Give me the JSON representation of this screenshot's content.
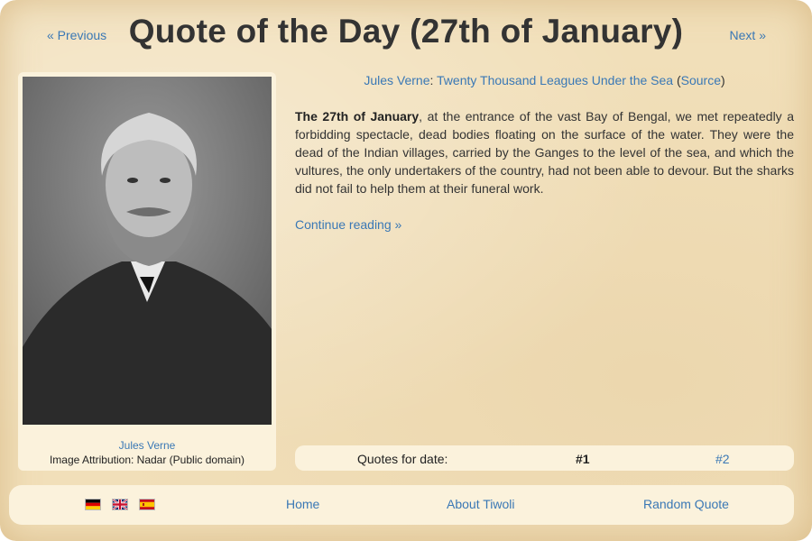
{
  "nav": {
    "previous_label": "« Previous",
    "next_label": "Next »"
  },
  "title": "Quote of the Day (27th of January)",
  "portrait": {
    "author_link": "Jules Verne",
    "attribution": "Image Attribution: Nadar (Public domain)"
  },
  "quote": {
    "author": "Jules Verne",
    "separator": ": ",
    "book": "Twenty Thousand Leagues Under the Sea",
    "source_open": " (",
    "source_label": "Source",
    "source_close": ")",
    "date_bold": "The 27th of January",
    "text": ", at the entrance of the vast Bay of Bengal, we met repeatedly a forbidding spectacle, dead bodies floating on the surface of the water. They were the dead of the Indian villages, carried by the Ganges to the level of the sea, and which the vultures, the only undertakers of the country, had not been able to devour. But the sharks did not fail to help them at their funeral work.",
    "continue_label": "Continue reading »"
  },
  "quotes_for_date": {
    "label": "Quotes for date:",
    "current": "#1",
    "other": "#2"
  },
  "footer": {
    "flags": [
      "german-flag-icon",
      "uk-flag-icon",
      "spanish-flag-icon"
    ],
    "home": "Home",
    "about": "About Tiwoli",
    "random": "Random Quote"
  },
  "colors": {
    "link": "#3a78b5",
    "parchment": "#f1dfb9",
    "panel": "#fbf2dc"
  }
}
